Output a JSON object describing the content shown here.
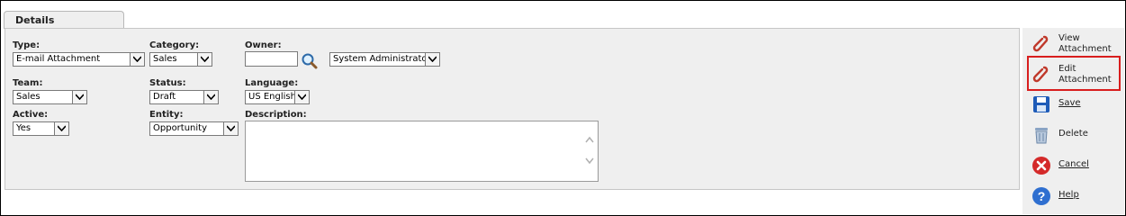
{
  "tabs": [
    {
      "label": "Details"
    }
  ],
  "form": {
    "type": {
      "label": "Type:",
      "value": "E-mail Attachment"
    },
    "category": {
      "label": "Category:",
      "value": "Sales"
    },
    "owner": {
      "label": "Owner:",
      "value": "",
      "selected": "System Administrator"
    },
    "team": {
      "label": "Team:",
      "value": "Sales"
    },
    "status": {
      "label": "Status:",
      "value": "Draft"
    },
    "language": {
      "label": "Language:",
      "value": "US English"
    },
    "active": {
      "label": "Active:",
      "value": "Yes"
    },
    "entity": {
      "label": "Entity:",
      "value": "Opportunity"
    },
    "description": {
      "label": "Description:",
      "value": ""
    }
  },
  "actions": {
    "view": {
      "line1": "View",
      "line2": "Attachment"
    },
    "edit": {
      "line1": "Edit",
      "line2": "Attachment"
    },
    "save": {
      "label": "Save"
    },
    "delete": {
      "label": "Delete"
    },
    "cancel": {
      "label": "Cancel"
    },
    "help": {
      "label": "Help"
    }
  },
  "colors": {
    "highlight": "#d81e1e",
    "panel": "#efefef",
    "save_icon": "#1e5bb8",
    "cancel_icon": "#d42a2a",
    "help_icon": "#2f6fd0",
    "clip_icon": "#c0392b"
  }
}
